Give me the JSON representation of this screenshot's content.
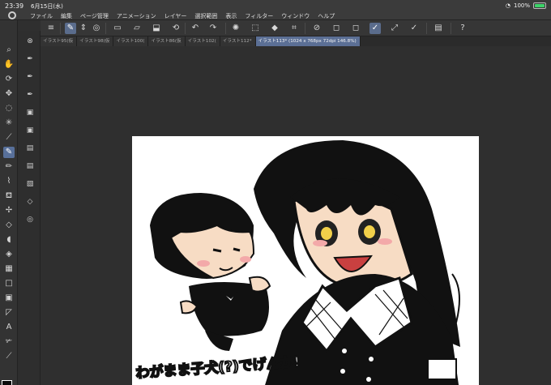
{
  "status": {
    "time": "23:39",
    "date": "6月15日(水)",
    "battery": "100%"
  },
  "menu": [
    "ファイル",
    "編集",
    "ページ管理",
    "アニメーション",
    "レイヤー",
    "選択範囲",
    "表示",
    "フィルター",
    "ウィンドウ",
    "ヘルプ"
  ],
  "tabs": [
    "イラスト95(仮",
    "イラスト98(仮",
    "イラスト100(",
    "イラスト86(仮",
    "イラスト102(",
    "イラスト112*",
    "イラスト113* (1024 x 768px 72dpi 146.8%)"
  ],
  "toolbar_icons": [
    "menu-icon",
    "quick-access-icon",
    "expand-icon",
    "new-icon",
    "open-icon",
    "save-icon",
    "undo-icon",
    "redo-icon",
    "transform-icon",
    "clear-icon",
    "fill-icon",
    "crop-icon",
    "snap-icon",
    "ruler-icon",
    "perspective-icon",
    "check-icon",
    "edit-icon",
    "pen-icon",
    "layer-icon",
    "help-icon"
  ],
  "tools_main": [
    "zoom",
    "hand",
    "rotate",
    "move",
    "lasso",
    "wand",
    "eyedropper",
    "pen",
    "pencil",
    "brush",
    "airbrush",
    "decoration",
    "eraser",
    "blend",
    "fill",
    "gradient",
    "shape",
    "frame",
    "ruler",
    "text",
    "balloon",
    "correction"
  ],
  "tools_sub": [
    "reset",
    "ink",
    "marker",
    "g-pen",
    "round",
    "mapping",
    "realistic",
    "soft",
    "texture",
    "layer",
    "3d"
  ],
  "colors": {
    "accent": "#5b6f95",
    "bg": "#2f2f2f",
    "panel": "#363636",
    "main_color": "#0b0b0b",
    "sub_color": "#ffffff"
  },
  "artwork": {
    "caption": "わがまま子犬(?)でげんか!"
  }
}
